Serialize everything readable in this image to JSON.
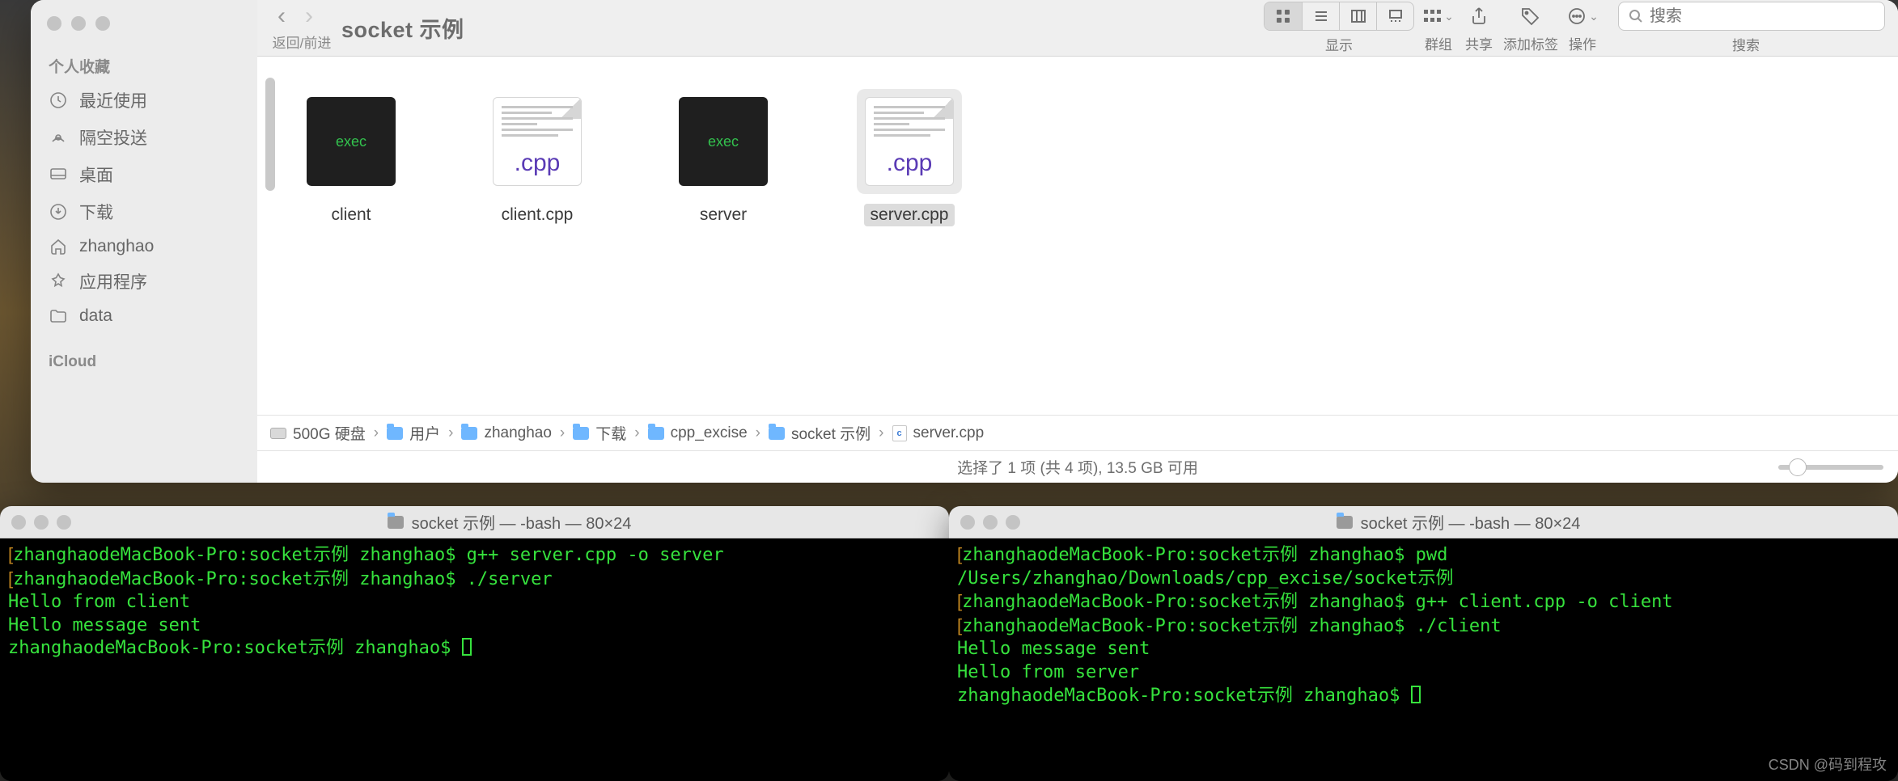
{
  "finder": {
    "title": "socket 示例",
    "nav_label": "返回/前进",
    "view_label": "显示",
    "groups_label": "群组",
    "share_label": "共享",
    "tags_label": "添加标签",
    "actions_label": "操作",
    "search_label": "搜索",
    "search_placeholder": "搜索",
    "sidebar": {
      "section1": "个人收藏",
      "section2": "iCloud",
      "items": [
        {
          "label": "最近使用"
        },
        {
          "label": "隔空投送"
        },
        {
          "label": "桌面"
        },
        {
          "label": "下载"
        },
        {
          "label": "zhanghao"
        },
        {
          "label": "应用程序"
        },
        {
          "label": "data"
        }
      ]
    },
    "files": [
      {
        "name": "client",
        "type": "exec",
        "exec_label": "exec"
      },
      {
        "name": "client.cpp",
        "type": "cpp",
        "ext": ".cpp"
      },
      {
        "name": "server",
        "type": "exec",
        "exec_label": "exec"
      },
      {
        "name": "server.cpp",
        "type": "cpp",
        "ext": ".cpp",
        "selected": true
      }
    ],
    "path": [
      {
        "label": "500G 硬盘",
        "kind": "drive"
      },
      {
        "label": "用户",
        "kind": "folder"
      },
      {
        "label": "zhanghao",
        "kind": "folder"
      },
      {
        "label": "下载",
        "kind": "folder"
      },
      {
        "label": "cpp_excise",
        "kind": "folder"
      },
      {
        "label": "socket 示例",
        "kind": "folder"
      },
      {
        "label": "server.cpp",
        "kind": "cpp"
      }
    ],
    "status": "选择了 1 项 (共 4 项),  13.5 GB 可用"
  },
  "terminal_left": {
    "title": "socket 示例 — -bash — 80×24",
    "lines": [
      "[zhanghaodeMacBook-Pro:socket示例 zhanghao$ g++ server.cpp -o server",
      "[zhanghaodeMacBook-Pro:socket示例 zhanghao$ ./server",
      "Hello from client",
      "Hello message sent",
      "zhanghaodeMacBook-Pro:socket示例 zhanghao$ "
    ]
  },
  "terminal_right": {
    "title": "socket 示例 — -bash — 80×24",
    "lines": [
      "[zhanghaodeMacBook-Pro:socket示例 zhanghao$ pwd",
      "/Users/zhanghao/Downloads/cpp_excise/socket示例",
      "[zhanghaodeMacBook-Pro:socket示例 zhanghao$ g++ client.cpp -o client",
      "[zhanghaodeMacBook-Pro:socket示例 zhanghao$ ./client",
      "Hello message sent",
      "Hello from server",
      "zhanghaodeMacBook-Pro:socket示例 zhanghao$ "
    ]
  },
  "watermark": "CSDN @码到程攻",
  "traffic_colors": {
    "close": "#c4c4c4",
    "min": "#c4c4c4",
    "max": "#c4c4c4"
  }
}
